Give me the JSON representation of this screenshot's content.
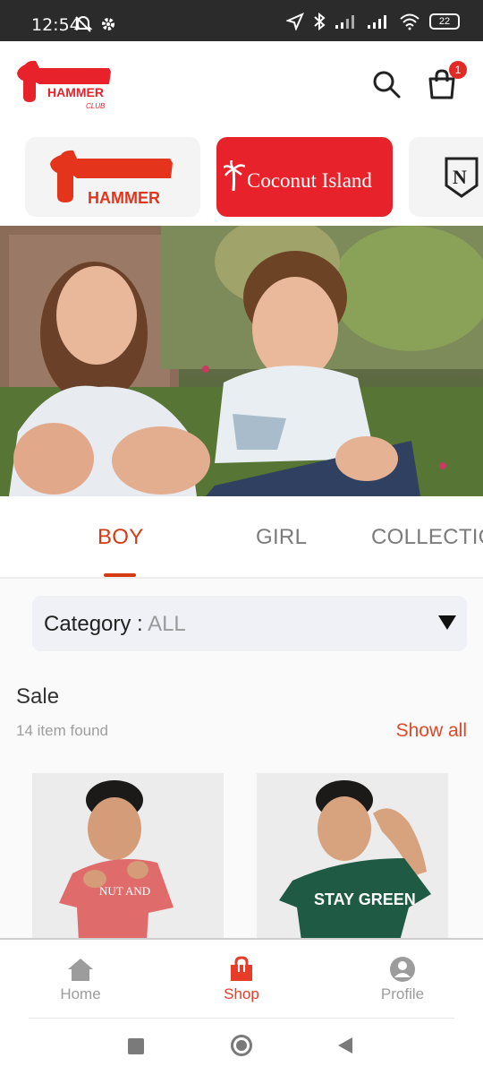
{
  "status_bar": {
    "time": "12:54",
    "battery": "22"
  },
  "header": {
    "logo_text": "HAMMER",
    "logo_sub": "CLUB",
    "cart_count": "1"
  },
  "brands": [
    {
      "label": "HAMMER"
    },
    {
      "label": "Coconut Island"
    },
    {
      "label": "N"
    }
  ],
  "tabs": [
    {
      "label": "BOY",
      "active": true
    },
    {
      "label": "GIRL",
      "active": false
    },
    {
      "label": "COLLECTIO",
      "active": false
    }
  ],
  "category": {
    "label": "Category : ",
    "value": "ALL"
  },
  "sale": {
    "title": "Sale",
    "count": "14 item found",
    "show_all": "Show all",
    "products": [
      {
        "shirt_color": "#e06b6b",
        "shirt_text": "NUT AND"
      },
      {
        "shirt_color": "#1f5a45",
        "shirt_text": "STAY GREEN"
      }
    ]
  },
  "bottom_nav": {
    "items": [
      {
        "label": "Home",
        "icon": "home-icon"
      },
      {
        "label": "Shop",
        "icon": "shop-icon"
      },
      {
        "label": "Profile",
        "icon": "profile-icon"
      }
    ]
  },
  "colors": {
    "accent": "#e04827",
    "brand_red": "#e8222a"
  }
}
